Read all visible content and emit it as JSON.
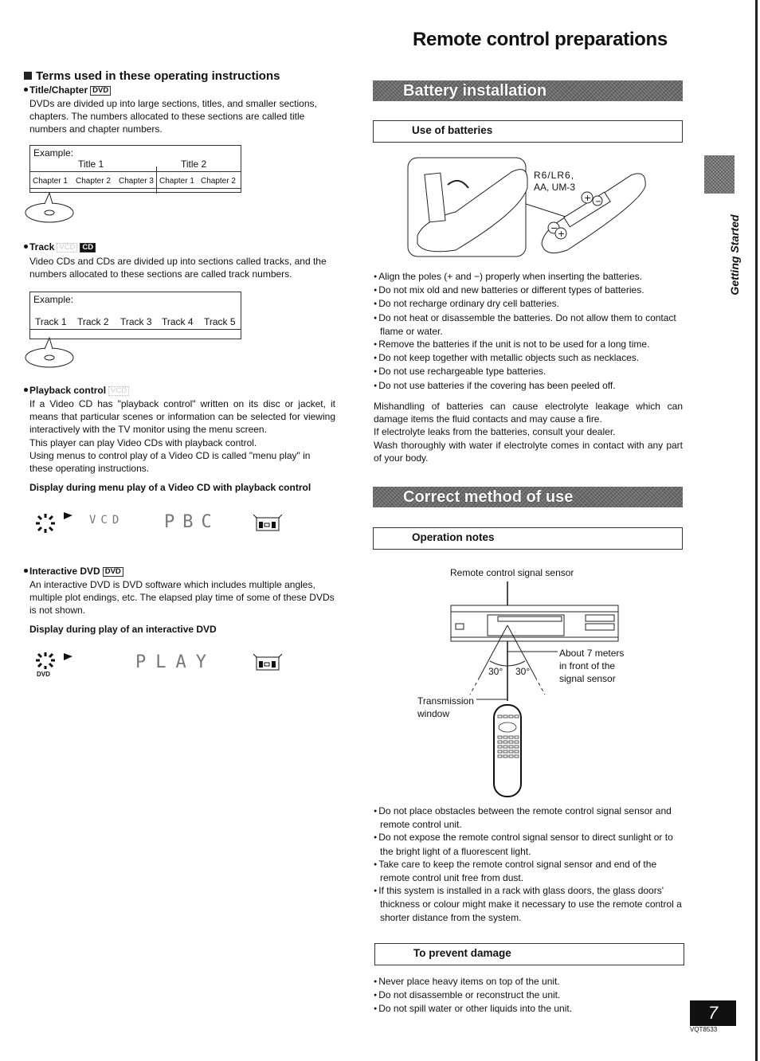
{
  "page": {
    "title": "Remote control preparations",
    "side_label": "Getting Started",
    "page_number": "7",
    "doc_code": "VQT8533"
  },
  "left": {
    "section_title": "Terms used in these operating instructions",
    "title_chapter": {
      "term": "Title/Chapter",
      "badge": "DVD",
      "text": "DVDs are divided up into large sections, titles, and smaller sections, chapters. The numbers allocated to these sections are called title numbers and chapter numbers.",
      "example_label": "Example:",
      "titles": [
        "Title 1",
        "Title 2"
      ],
      "chapters": [
        "Chapter 1",
        "Chapter 2",
        "Chapter 3",
        "Chapter 1",
        "Chapter 2"
      ]
    },
    "track": {
      "term": "Track",
      "badge_ghost": "VCD",
      "badge": "CD",
      "text": "Video CDs and CDs are divided up into sections called tracks, and the numbers allocated to these sections are called track numbers.",
      "example_label": "Example:",
      "tracks": [
        "Track 1",
        "Track 2",
        "Track 3",
        "Track 4",
        "Track 5"
      ]
    },
    "playback_control": {
      "term": "Playback control",
      "badge_ghost": "VCD",
      "text1": "If a Video CD has \"playback control\" written on its disc or jacket, it means that particular scenes or information can be selected for viewing interactively with the TV monitor using the menu screen.",
      "text2": "This player can play Video CDs with playback control.",
      "text3": "Using menus to control play of a Video CD is called \"menu play\" in these operating instructions.",
      "display_heading": "Display during menu play of a Video CD with playback control",
      "display_text1": "VCD",
      "display_text2": "PBC"
    },
    "interactive_dvd": {
      "term": "Interactive DVD",
      "badge": "DVD",
      "text": "An interactive DVD is DVD software which includes multiple angles, multiple plot endings, etc. The elapsed play time of some of these DVDs is not shown.",
      "display_heading": "Display during play of an interactive DVD",
      "display_text": "PLAY",
      "disc_label": "DVD"
    }
  },
  "right": {
    "battery_banner": "Battery installation",
    "use_of_batteries": {
      "heading": "Use of batteries",
      "battery_type_line1": "R6/LR6,",
      "battery_type_line2": "AA, UM-3",
      "bullets": [
        "Align the poles (+ and −) properly when inserting the batteries.",
        "Do not mix old and new batteries or different types of batteries.",
        "Do not recharge ordinary dry cell batteries.",
        "Do not heat or disassemble the batteries. Do not allow them to contact flame or water.",
        "Remove the batteries if the unit is not to be used for a long time.",
        "Do not keep together with metallic objects such as necklaces.",
        "Do not use rechargeable type batteries.",
        "Do not use batteries if the covering has been peeled off."
      ],
      "warning": [
        "Mishandling of batteries can cause electrolyte leakage which can damage items the fluid contacts and may cause a fire.",
        "If electrolyte leaks from the batteries, consult your dealer.",
        "Wash thoroughly with water if electrolyte comes in contact with any part of your body."
      ]
    },
    "correct_banner": "Correct method of use",
    "operation_notes": {
      "heading": "Operation notes",
      "sensor_label": "Remote control signal sensor",
      "distance_line1": "About 7 meters",
      "distance_line2": "in front of the",
      "distance_line3": "signal sensor",
      "angle_left": "30°",
      "angle_right": "30°",
      "window_line1": "Transmission",
      "window_line2": "window",
      "bullets": [
        "Do not place obstacles between the remote control signal sensor and remote control unit.",
        "Do not expose the remote control signal sensor to direct sunlight or to the bright light of a fluorescent light.",
        "Take care to keep the remote control signal sensor and end of the remote control unit free from dust.",
        "If this system is installed in a rack with glass doors, the glass doors' thickness or colour might make it necessary to use the remote control a shorter distance from the system."
      ]
    },
    "prevent_damage": {
      "heading": "To prevent damage",
      "bullets": [
        "Never place heavy items on top of the unit.",
        "Do not disassemble or reconstruct the unit.",
        "Do not spill water or other liquids into the unit."
      ]
    }
  }
}
